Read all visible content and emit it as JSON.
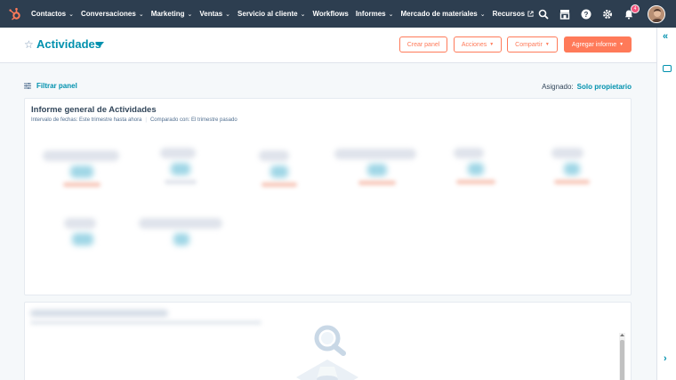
{
  "nav": {
    "items": [
      {
        "label": "Contactos",
        "chevron": true
      },
      {
        "label": "Conversaciones",
        "chevron": true
      },
      {
        "label": "Marketing",
        "chevron": true
      },
      {
        "label": "Ventas",
        "chevron": true
      },
      {
        "label": "Servicio al cliente",
        "chevron": true
      },
      {
        "label": "Workflows",
        "chevron": false
      },
      {
        "label": "Informes",
        "chevron": true
      },
      {
        "label": "Mercado de materiales",
        "chevron": true
      },
      {
        "label": "Recursos",
        "chevron": false,
        "external": true
      }
    ],
    "notification_count": "4",
    "colors": {
      "bar": "#2d3e50",
      "logo": "#ff7a59"
    }
  },
  "header": {
    "title": "Actividades",
    "buttons": {
      "create": "Crear panel",
      "actions": "Acciones",
      "share": "Compartir",
      "add_report": "Agregar informe"
    }
  },
  "filter": {
    "label": "Filtrar panel",
    "assigned_label": "Asignado:",
    "assigned_value": "Solo propietario"
  },
  "report": {
    "title": "Informe general de Actividades",
    "date_range": "Intervalo de fechas:  Este trimestre hasta ahora",
    "compared": "Comparado con: El trimestre pasado"
  },
  "colors": {
    "accent": "#0091ae",
    "cta": "#ff7a59",
    "text": "#33475b"
  }
}
